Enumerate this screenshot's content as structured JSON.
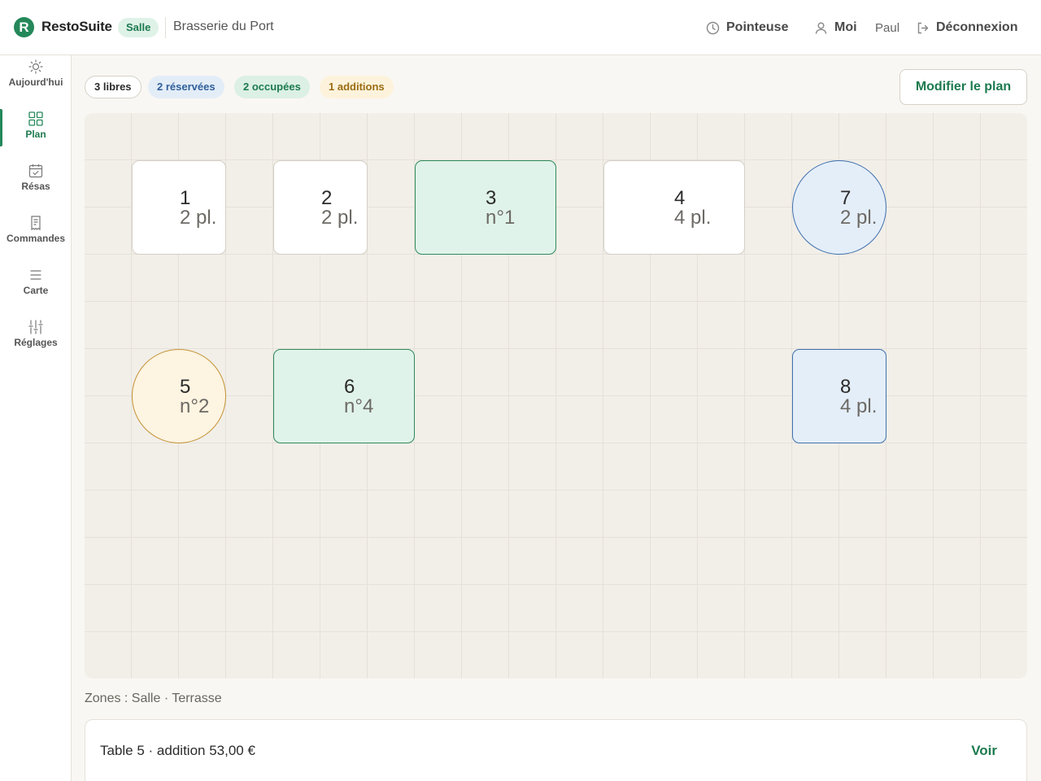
{
  "header": {
    "logo_letter": "R",
    "app_name": "RestoSuite",
    "mode_badge": "Salle",
    "restaurant": "Brasserie du Port",
    "timeclock_label": "Pointeuse",
    "me_label": "Moi",
    "user_name": "Paul",
    "logout_label": "Déconnexion"
  },
  "sidebar": {
    "items": [
      {
        "label": "Aujourd'hui",
        "icon": "sun-icon"
      },
      {
        "label": "Plan",
        "icon": "grid-icon",
        "active": true
      },
      {
        "label": "Résas",
        "icon": "calendar-check-icon"
      },
      {
        "label": "Commandes",
        "icon": "receipt-icon"
      },
      {
        "label": "Carte",
        "icon": "list-icon"
      },
      {
        "label": "Réglages",
        "icon": "sliders-icon"
      }
    ]
  },
  "status": {
    "free": "3 libres",
    "reserved": "2 réservées",
    "occupied": "2 occupées",
    "bills": "1 additions"
  },
  "edit_plan_label": "Modifier le plan",
  "tables": [
    {
      "number": "1",
      "sub": "2 pl.",
      "status": "free"
    },
    {
      "number": "2",
      "sub": "2 pl.",
      "status": "free"
    },
    {
      "number": "3",
      "sub": "n°1",
      "status": "occupied"
    },
    {
      "number": "4",
      "sub": "4 pl.",
      "status": "free"
    },
    {
      "number": "7",
      "sub": "2 pl.",
      "status": "reserved"
    },
    {
      "number": "5",
      "sub": "n°2",
      "status": "bill"
    },
    {
      "number": "6",
      "sub": "n°4",
      "status": "occupied"
    },
    {
      "number": "8",
      "sub": "4 pl.",
      "status": "reserved"
    }
  ],
  "zones_text": "Zones : Salle · Terrasse",
  "bill_panel": {
    "text": "Table 5 · addition 53,00 €",
    "action": "Voir"
  },
  "colors": {
    "brand": "#24885a",
    "occupied": "#2e8a5b",
    "reserved": "#3f70ad",
    "bill": "#c49234"
  }
}
